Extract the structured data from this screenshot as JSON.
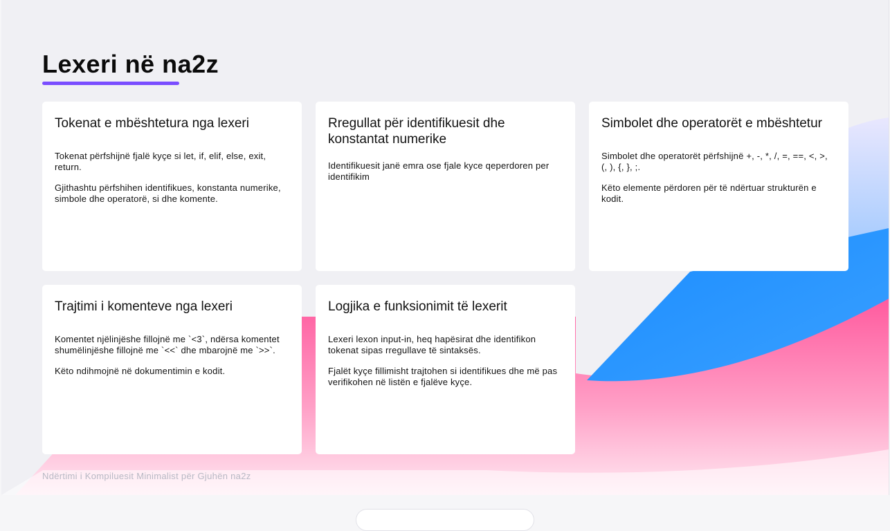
{
  "title": "Lexeri në na2z",
  "cards": [
    {
      "heading": "Tokenat e mbështetura nga lexeri",
      "paragraphs": [
        "Tokenat përfshijnë fjalë kyçe si let, if, elif, else, exit, return.",
        "Gjithashtu përfshihen identifikues, konstanta numerike, simbole dhe operatorë, si dhe komente."
      ]
    },
    {
      "heading": "Rregullat për identifikuesit dhe konstantat numerike",
      "paragraphs": [
        "Identifikuesit janë emra ose fjale kyce qeperdoren per identifikim"
      ]
    },
    {
      "heading": "Simbolet dhe operatorët e mbështetur",
      "paragraphs": [
        "Simbolet dhe operatorët përfshijnë +, -, *, /, =, ==, <, >, (, ), {, }, ;.",
        "Këto elemente përdoren për të ndërtuar strukturën e kodit."
      ]
    },
    {
      "heading": "Trajtimi i komenteve nga lexeri",
      "paragraphs": [
        "Komentet njëlinjëshe fillojnë me `<3`, ndërsa komentet shumëlinjëshe fillojnë me `<<` dhe mbarojnë me `>>`.",
        "Këto ndihmojnë në dokumentimin e kodit."
      ]
    },
    {
      "heading": "Logjika e funksionimit të lexerit",
      "paragraphs": [
        "Lexeri lexon input-in, heq hapësirat dhe identifikon tokenat sipas rregullave të sintaksës.",
        "Fjalët kyçe fillimisht trajtohen si identifikues dhe më pas verifikohen në listën e fjalëve kyçe."
      ]
    }
  ],
  "footer": "Ndërtimi i Kompiluesit Minimalist për Gjuhën na2z",
  "colors": {
    "accent": "#7a4dff",
    "blue": "#1f8fff",
    "pink": "#ff5fa2",
    "background": "#f0f0f4"
  }
}
